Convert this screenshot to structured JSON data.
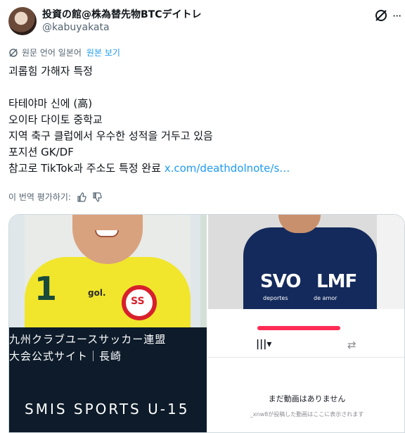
{
  "author": {
    "display_name": "投資の館@株為替先物BTCデイトレ",
    "handle": "@kabuyakata",
    "top_icon": "grok-icon",
    "more_icon": "more-dots-icon"
  },
  "translation_bar": {
    "source_label": "원문 언어 일본어",
    "view_original": "원본 보기"
  },
  "tweet": {
    "lines": [
      "괴롭힘 가해자 특정",
      "",
      "타테야마 신에 (高)",
      "오이타 다이토 중학교",
      "지역 축구 클럽에서 우수한 성적을 거두고 있음",
      "포지션 GK/DF"
    ],
    "last_line_text": "참고로 TikTok과 주소도 특정 완료 ",
    "last_line_link": "x.com/deathdolnote/s…"
  },
  "rate_translation": {
    "label": "이 번역 평가하기:"
  },
  "media": {
    "left": {
      "jersey_number": "1",
      "jersey_brand": "gol.",
      "caption_line1": "九州クラブユースサッカー連盟",
      "caption_line2": "大会公式サイト｜長崎",
      "caption_big": "SMIS SPORTS U-15"
    },
    "right": {
      "jacket_text_left": "SVO",
      "jacket_text_right": "LMF",
      "jacket_sub_left": "deportes",
      "jacket_sub_right": "de amor",
      "empty_title": "まだ動画はありません",
      "empty_sub": "_xnw8が投稿した動画はここに表示されます"
    }
  },
  "colors": {
    "link": "#1d9bf0",
    "muted": "#536471",
    "tiktok_accent": "#fe2c55"
  }
}
